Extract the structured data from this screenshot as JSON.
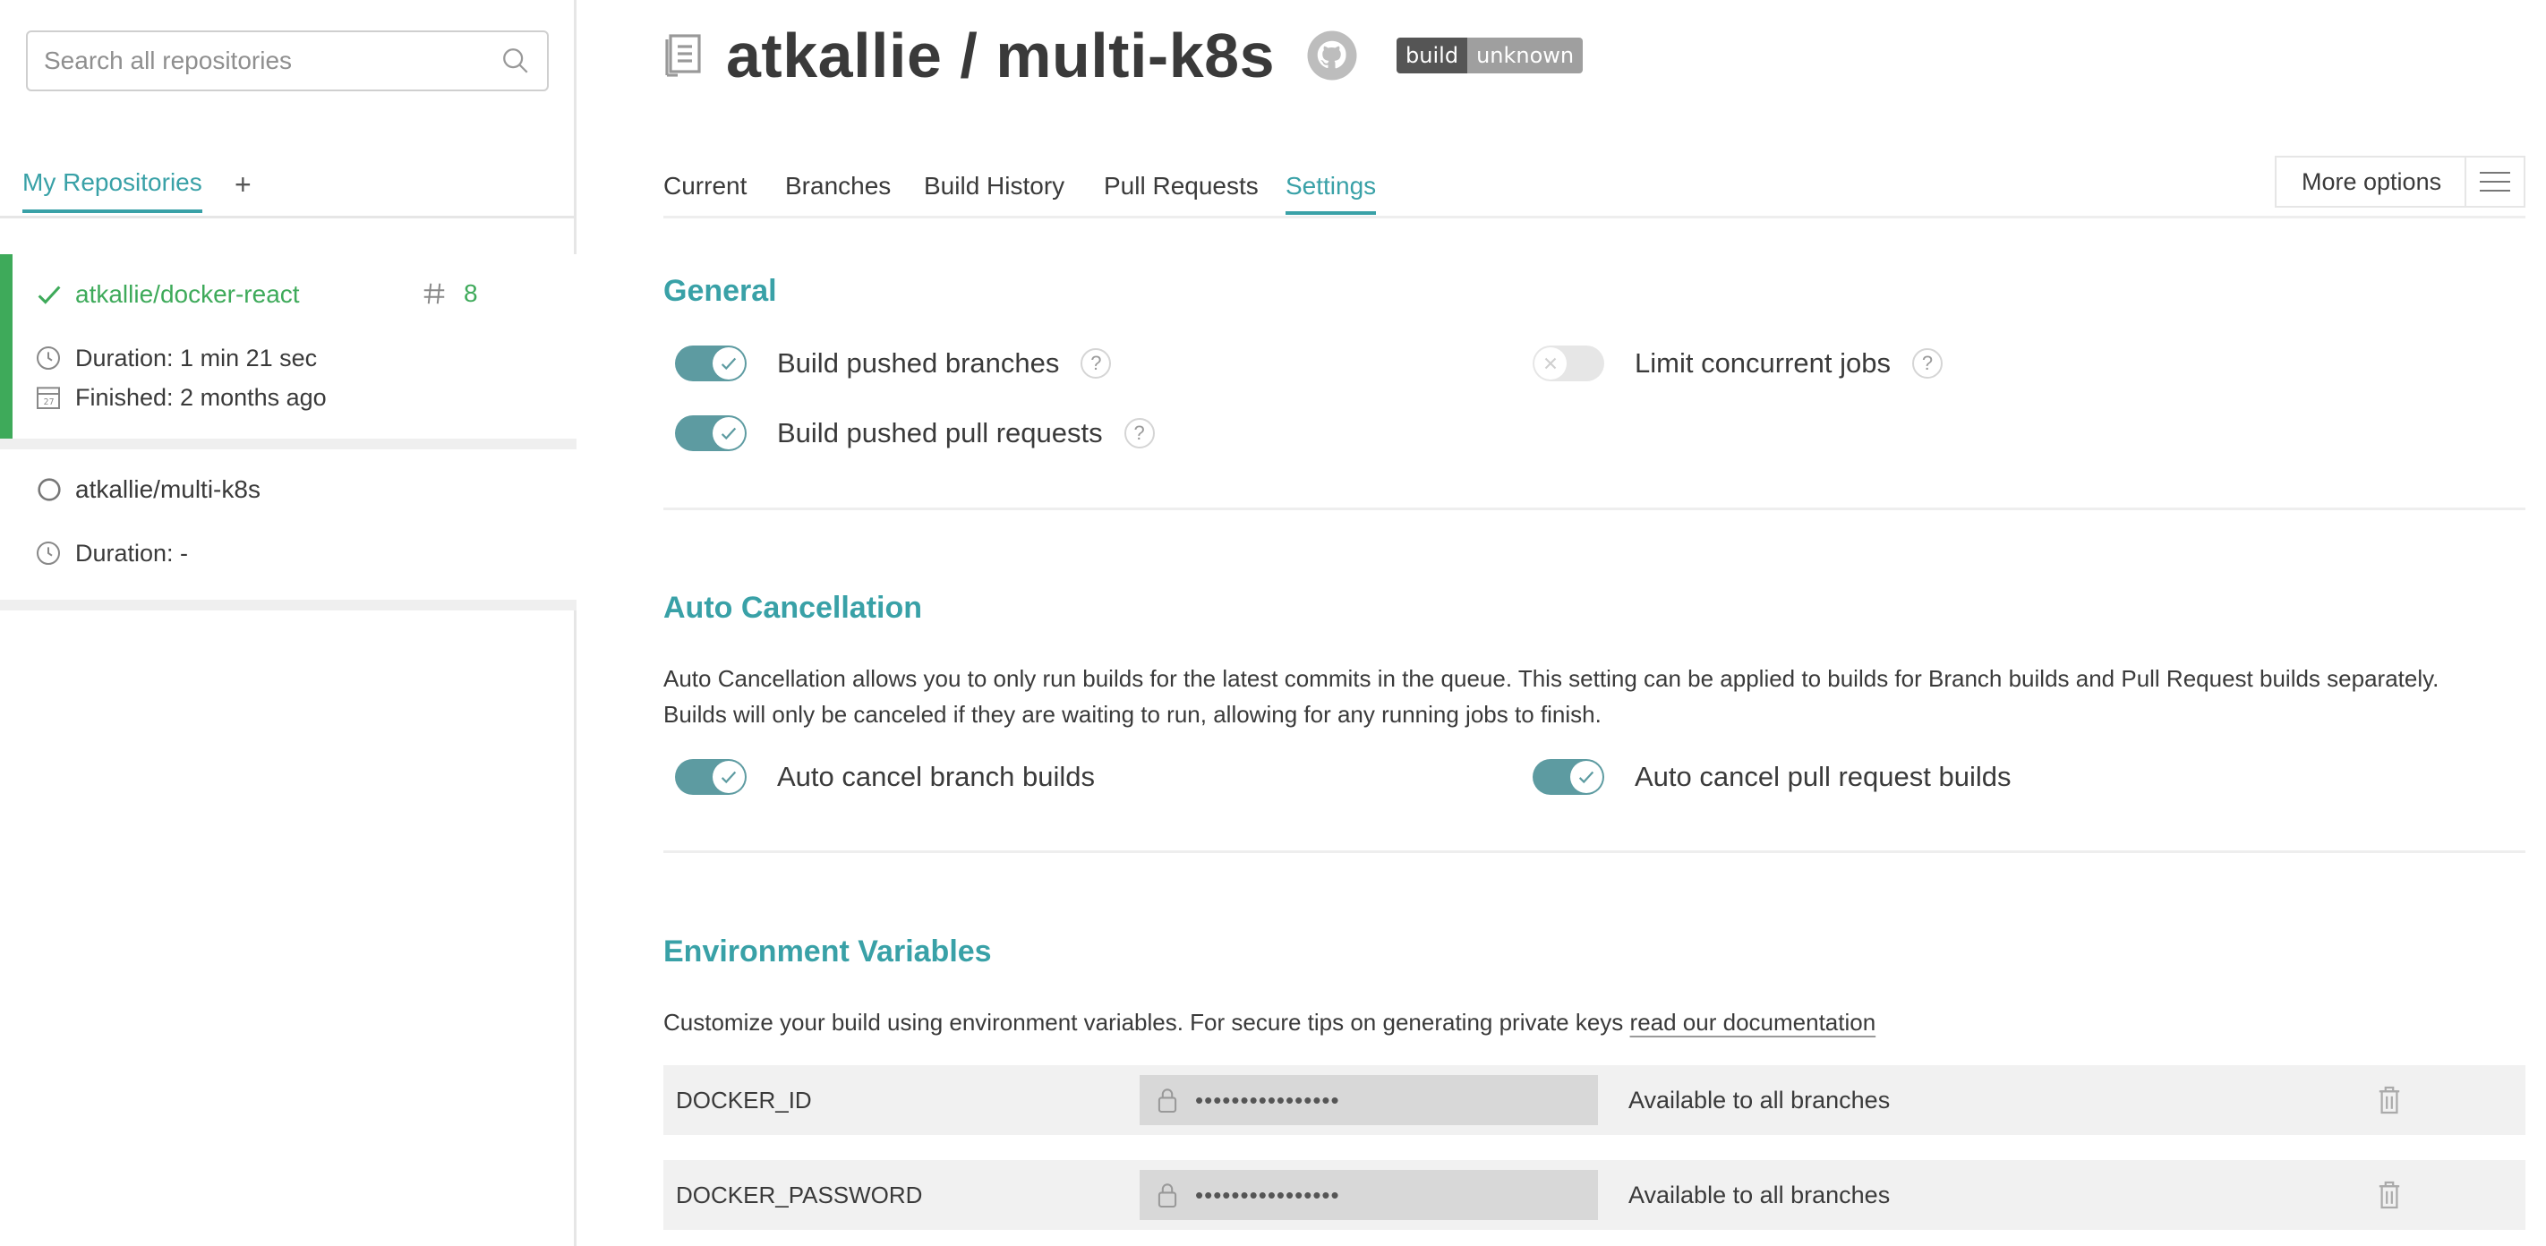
{
  "sidebar": {
    "search_placeholder": "Search all repositories",
    "tab_my_repos": "My Repositories",
    "tab_add": "+",
    "repos": [
      {
        "name": "atkallie/docker-react",
        "status": "passed",
        "build_number": "8",
        "duration": "Duration: 1 min 21 sec",
        "finished": "Finished: 2 months ago"
      },
      {
        "name": "atkallie/multi-k8s",
        "status": "none",
        "duration": "Duration: -"
      }
    ]
  },
  "header": {
    "title": "atkallie / multi-k8s",
    "badge_left": "build",
    "badge_right": "unknown"
  },
  "tabs": {
    "current": "Current",
    "branches": "Branches",
    "build_history": "Build History",
    "pull_requests": "Pull Requests",
    "settings": "Settings",
    "more_options": "More options"
  },
  "general": {
    "title": "General",
    "build_pushed_branches": "Build pushed branches",
    "build_pushed_pull_requests": "Build pushed pull requests",
    "limit_concurrent_jobs": "Limit concurrent jobs",
    "help": "?"
  },
  "auto_cancellation": {
    "title": "Auto Cancellation",
    "description_line1": "Auto Cancellation allows you to only run builds for the latest commits in the queue. This setting can be applied to builds for Branch builds and Pull Request builds separately.",
    "description_line2": "Builds will only be canceled if they are waiting to run, allowing for any running jobs to finish.",
    "branch_builds": "Auto cancel branch builds",
    "pull_request_builds": "Auto cancel pull request builds"
  },
  "env_vars": {
    "title": "Environment Variables",
    "description": "Customize your build using environment variables. For secure tips on generating private keys",
    "doc_link": "read our documentation",
    "rows": [
      {
        "name": "DOCKER_ID",
        "value": "••••••••••••••••",
        "scope": "Available to all branches"
      },
      {
        "name": "DOCKER_PASSWORD",
        "value": "••••••••••••••••",
        "scope": "Available to all branches"
      }
    ]
  },
  "colors": {
    "accent": "#39a1a7",
    "success": "#3eaa5a",
    "toggle_on": "#5d9ba1"
  }
}
